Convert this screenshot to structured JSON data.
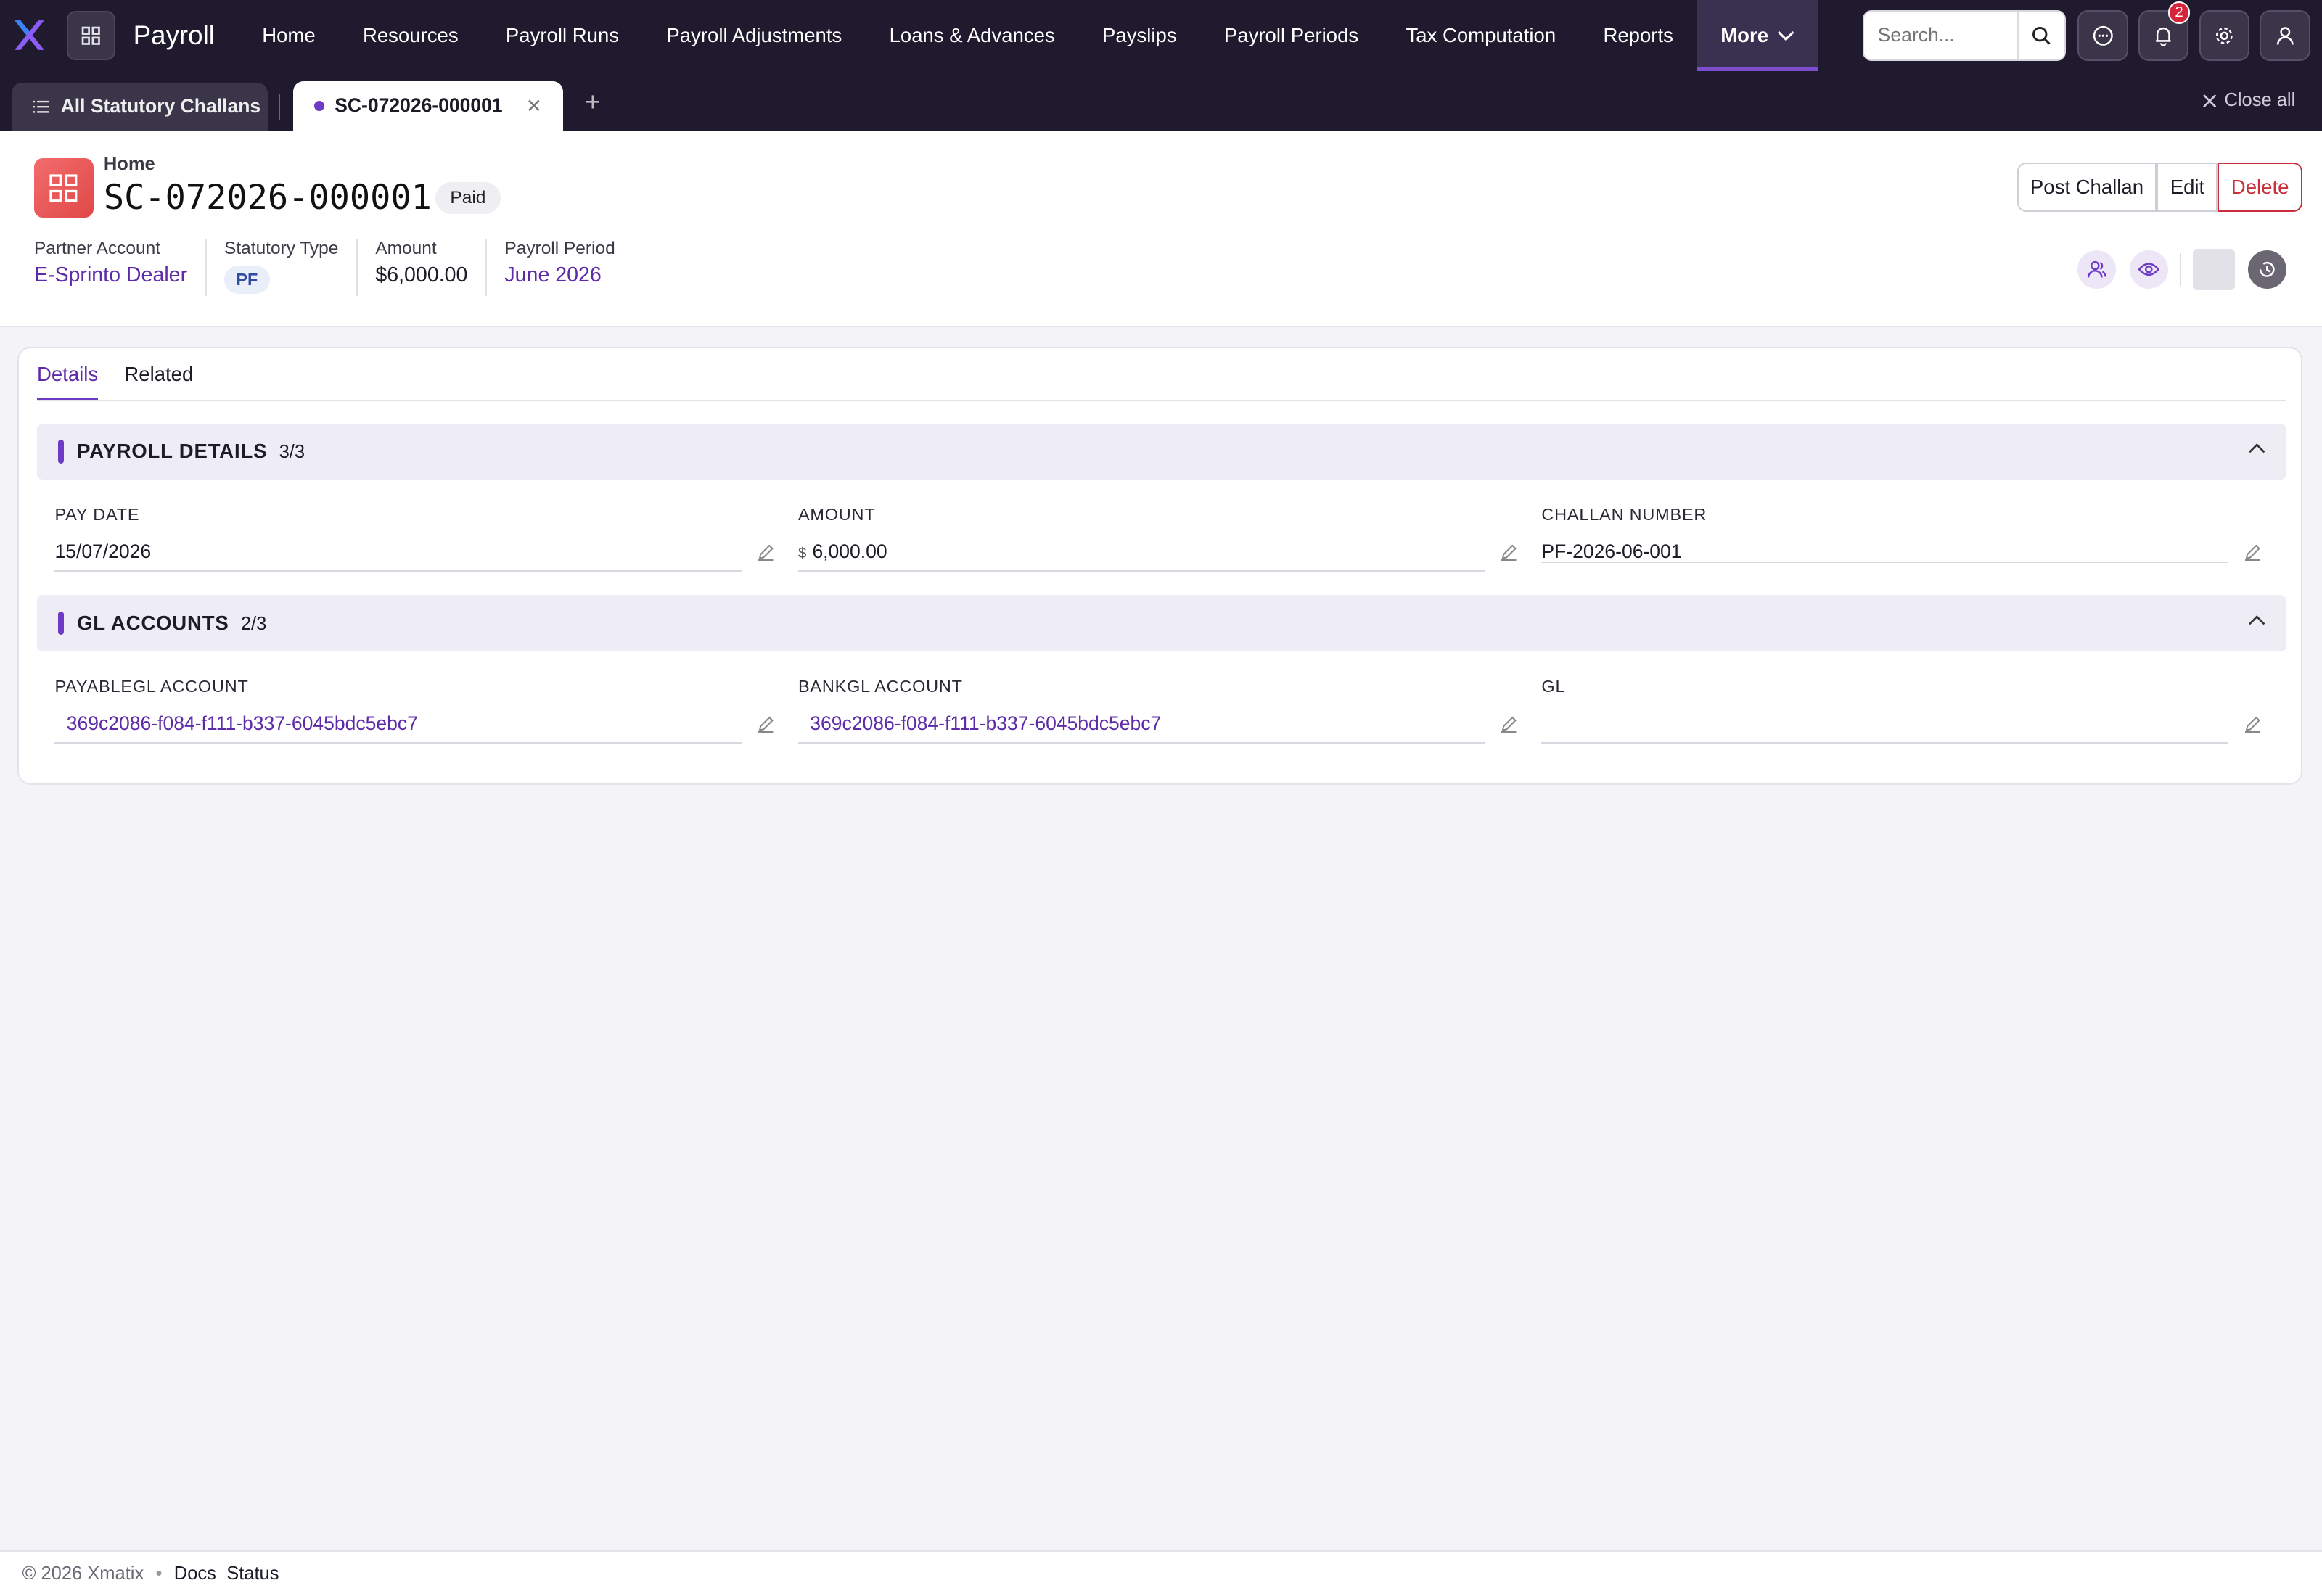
{
  "app": {
    "name": "Payroll"
  },
  "nav": {
    "items": [
      "Home",
      "Resources",
      "Payroll Runs",
      "Payroll Adjustments",
      "Loans & Advances",
      "Payslips",
      "Payroll Periods",
      "Tax Computation",
      "Reports"
    ],
    "more_label": "More"
  },
  "search": {
    "placeholder": "Search..."
  },
  "notifications": {
    "count": "2"
  },
  "tabs": {
    "list_tab": "All Statutory Challans",
    "record_tab": "SC-072026-000001",
    "close_all": "Close all"
  },
  "record": {
    "breadcrumb": "Home",
    "title": "SC-072026-000001",
    "status": "Paid",
    "actions": {
      "post": "Post Challan",
      "edit": "Edit",
      "delete": "Delete"
    },
    "facts": {
      "partner_label": "Partner Account",
      "partner_value": "E-Sprinto Dealer",
      "type_label": "Statutory Type",
      "type_value": "PF",
      "amount_label": "Amount",
      "amount_value": "$6,000.00",
      "period_label": "Payroll Period",
      "period_value": "June 2026"
    }
  },
  "content_tabs": {
    "details": "Details",
    "related": "Related"
  },
  "sections": {
    "payroll": {
      "title": "PAYROLL DETAILS",
      "count": "3/3",
      "pay_date_label": "PAY DATE",
      "pay_date_value": "15/07/2026",
      "amount_label": "AMOUNT",
      "amount_currency": "$",
      "amount_value": "6,000.00",
      "challan_label": "CHALLAN NUMBER",
      "challan_value": "PF-2026-06-001"
    },
    "gl": {
      "title": "GL ACCOUNTS",
      "count": "2/3",
      "payable_label": "PAYABLEGL ACCOUNT",
      "payable_value": "369c2086-f084-f111-b337-6045bdc5ebc7",
      "bank_label": "BANKGL ACCOUNT",
      "bank_value": "369c2086-f084-f111-b337-6045bdc5ebc7",
      "gl_label": "GL",
      "gl_value": ""
    }
  },
  "footer": {
    "copyright": "© 2026 Xmatix",
    "docs": "Docs",
    "status": "Status"
  }
}
